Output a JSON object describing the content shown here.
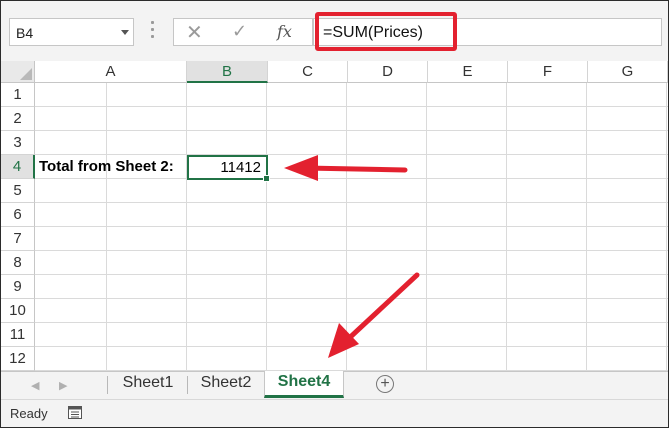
{
  "formula_bar": {
    "name_box": "B4",
    "formula": "=SUM(Prices)",
    "cancel_icon": "x-icon",
    "enter_icon": "check-icon",
    "function_label": "fx"
  },
  "grid": {
    "columns": [
      "A",
      "B",
      "C",
      "D",
      "E",
      "F",
      "G"
    ],
    "rows": [
      "1",
      "2",
      "3",
      "4",
      "5",
      "6",
      "7",
      "8",
      "9",
      "10",
      "11",
      "12"
    ],
    "active_column": "B",
    "active_row": "4",
    "cells": {
      "a4": "Total from Sheet 2:",
      "b4": "11412"
    }
  },
  "sheet_tabs": {
    "tabs": [
      "Sheet1",
      "Sheet2",
      "Sheet4"
    ],
    "active": "Sheet4",
    "add_label": "+"
  },
  "status": {
    "text": "Ready"
  },
  "colors": {
    "accent": "#217346",
    "annotation": "#e3212f"
  }
}
